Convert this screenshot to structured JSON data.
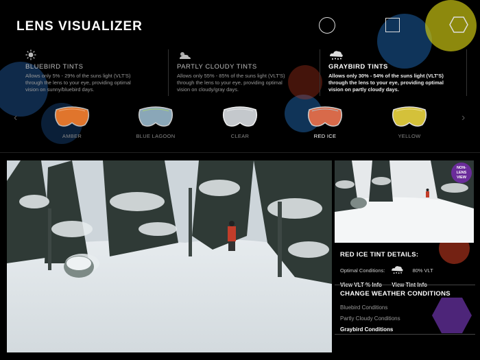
{
  "header": {
    "title": "LENS VISUALIZER",
    "shapes": [
      "circle-icon",
      "square-icon",
      "hexagon-icon"
    ]
  },
  "conditions": [
    {
      "name": "BLUEBIRD TINTS",
      "icon": "sun-icon",
      "active": false,
      "description": "Allows only 5% - 29% of the suns light (VLT'S) through the lens to your eye, providing optimal vision on sunny/bluebird days."
    },
    {
      "name": "PARTLY CLOUDY TINTS",
      "icon": "partly-cloudy-icon",
      "active": false,
      "description": "Allows only 55% - 85% of the suns light (VLT'S) through the lens to your eye, providing optimal vision on cloudy/gray days."
    },
    {
      "name": "GRAYBIRD TINTS",
      "icon": "cloud-snow-icon",
      "active": true,
      "description": "Allows only 30% - 54% of the suns light (VLT'S) through the lens to your eye, providing optimal vision on partly cloudy days."
    }
  ],
  "lenses": [
    {
      "label": "AMBER",
      "color": "#e0752c",
      "active": false
    },
    {
      "label": "BLUE LAGOON",
      "color": "#7f9fb3",
      "active": false
    },
    {
      "label": "CLEAR",
      "color": "#c4c8cc",
      "active": false
    },
    {
      "label": "RED ICE",
      "color": "#d86a4a",
      "active": true
    },
    {
      "label": "YELLOW",
      "color": "#d4c13a",
      "active": false
    }
  ],
  "preview": {
    "badge_line1": "NON-",
    "badge_line2": "LENS",
    "badge_line3": "VIEW"
  },
  "details": {
    "heading": "RED ICE TINT DETAILS:",
    "optimal_label": "Optimal Conditions:",
    "vlt": "80% VLT",
    "link_vlt": "View VLT % Info",
    "link_tint": "View Tint Info"
  },
  "weather": {
    "heading": "CHANGE WEATHER CONDITIONS",
    "items": [
      {
        "label": "Bluebird Conditions",
        "active": false
      },
      {
        "label": "Partly Cloudy Conditions",
        "active": false
      },
      {
        "label": "Graybird Conditions",
        "active": true
      }
    ]
  },
  "colors": {
    "accent_purple": "#6a2c9a",
    "bokeh_blue": "#1e6fb5",
    "bokeh_yellow": "#d8d21a",
    "bokeh_red": "#c2391f"
  }
}
